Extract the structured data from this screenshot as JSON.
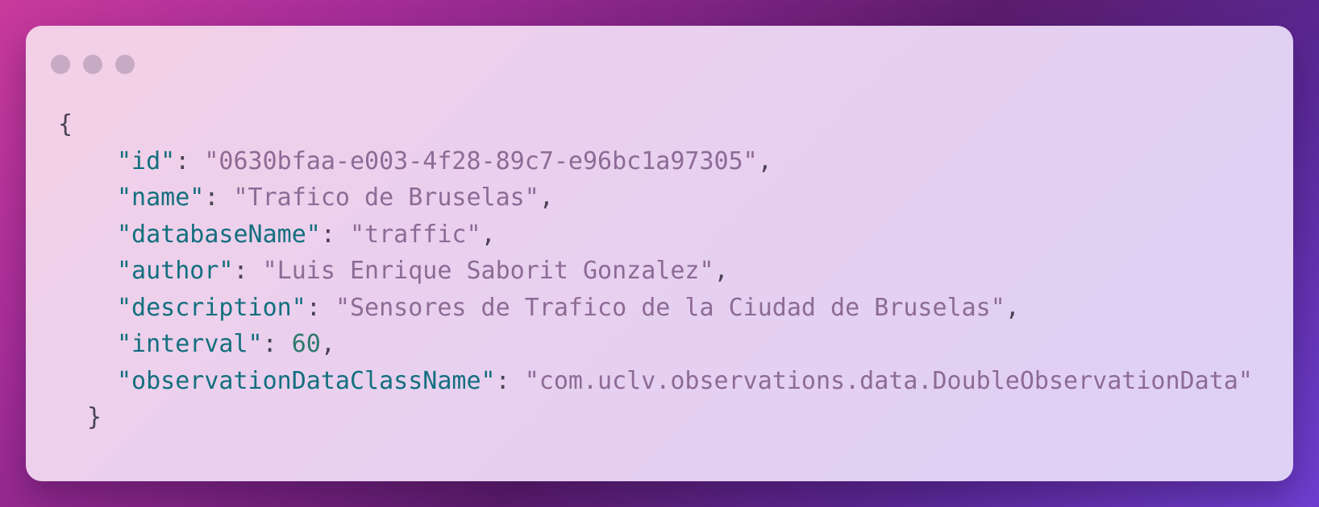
{
  "window": {
    "controls": [
      "close-dot",
      "minimize-dot",
      "maximize-dot"
    ]
  },
  "code": {
    "open_brace": "{",
    "close_brace": "}",
    "entries": [
      {
        "key": "\"id\"",
        "value": "\"0630bfaa-e003-4f28-89c7-e96bc1a97305\"",
        "type": "string",
        "comma": ","
      },
      {
        "key": "\"name\"",
        "value": "\"Trafico de Bruselas\"",
        "type": "string",
        "comma": ","
      },
      {
        "key": "\"databaseName\"",
        "value": "\"traffic\"",
        "type": "string",
        "comma": ","
      },
      {
        "key": "\"author\"",
        "value": "\"Luis Enrique Saborit Gonzalez\"",
        "type": "string",
        "comma": ","
      },
      {
        "key": "\"description\"",
        "value": "\"Sensores de Trafico de la Ciudad de Bruselas\"",
        "type": "string",
        "comma": ","
      },
      {
        "key": "\"interval\"",
        "value": "60",
        "type": "number",
        "comma": ","
      },
      {
        "key": "\"observationDataClassName\"",
        "value": "\"com.uclv.observations.data.DoubleObservationData\"",
        "type": "string",
        "comma": ""
      }
    ],
    "colon": ": "
  },
  "colors": {
    "key": "#136f7e",
    "string": "#8d6b96",
    "number": "#2d7a6c",
    "punctuation": "#4a4253"
  }
}
